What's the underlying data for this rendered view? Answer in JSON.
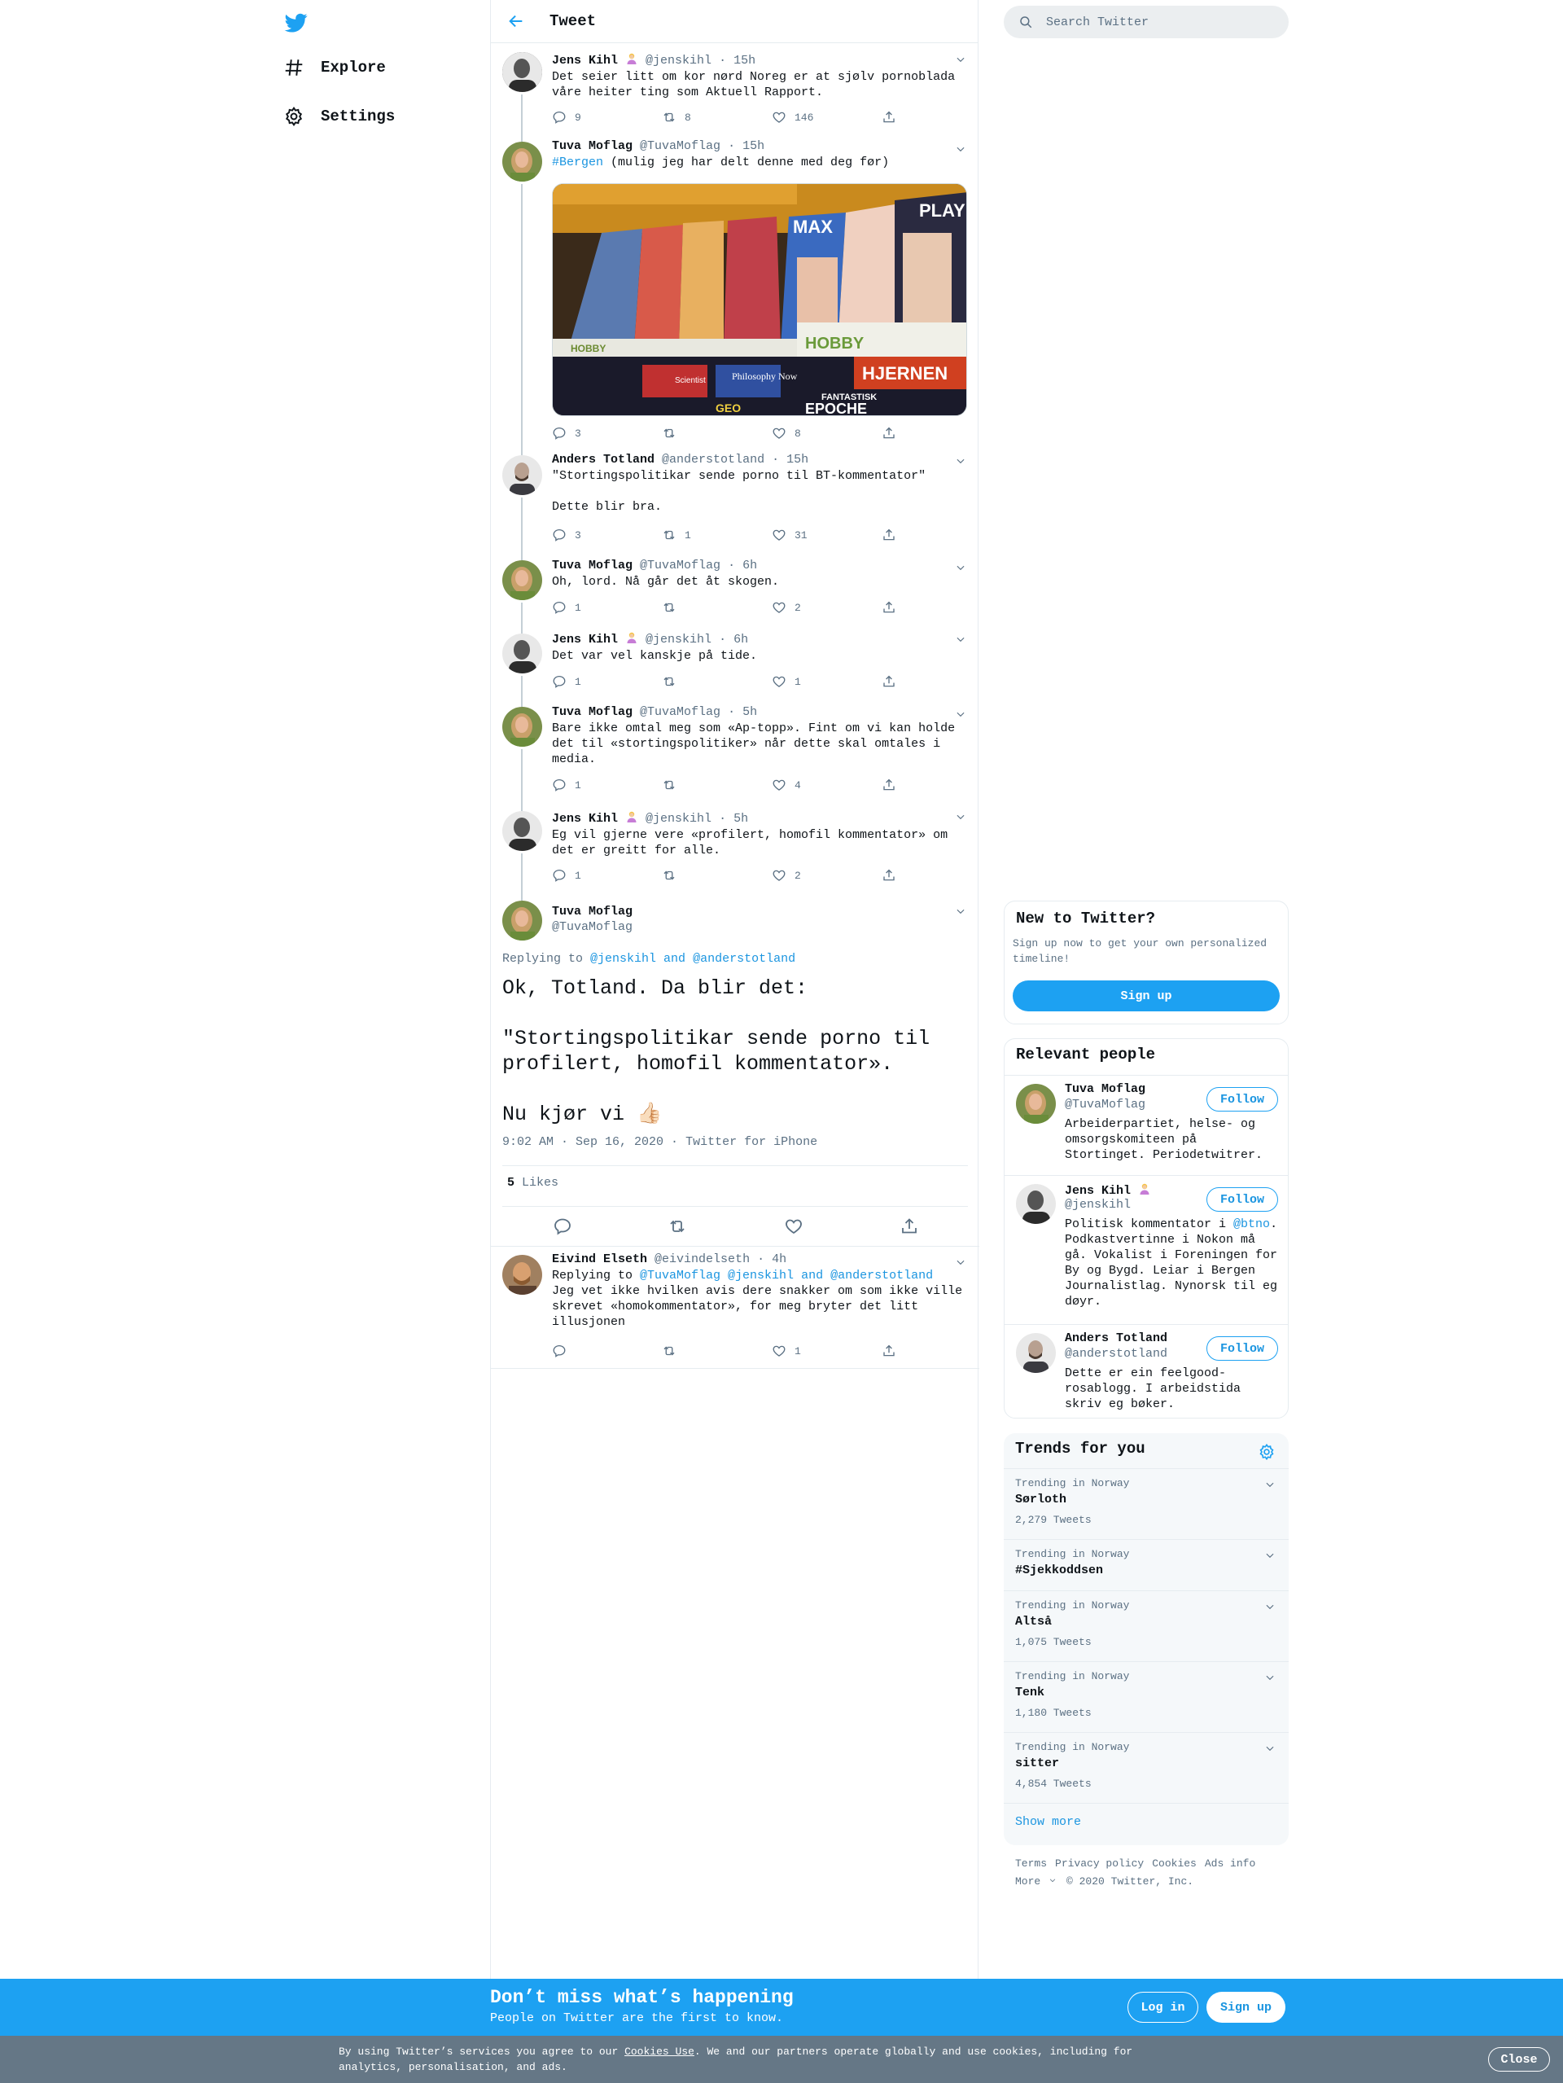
{
  "nav": {
    "logo": "twitter-bird-icon",
    "items": [
      {
        "label": "Explore",
        "icon": "hashtag-icon"
      },
      {
        "label": "Settings",
        "icon": "gear-icon"
      }
    ]
  },
  "header": {
    "title": "Tweet"
  },
  "thread": [
    {
      "name": "Jens Kihl",
      "emoji": "🙎‍♀️",
      "handle": "@jenskihl",
      "time": "· 15h",
      "text": "Det seier litt om kor nørd Noreg er at sjølv pornoblada våre heiter ting som Aktuell Rapport.",
      "replies": "9",
      "retweets": "8",
      "likes": "146"
    },
    {
      "name": "Tuva Moflag",
      "handle": "@TuvaMoflag",
      "time": "· 15h",
      "hashtag": "#Bergen",
      "text": " (mulig jeg har delt denne med deg før)",
      "replies": "3",
      "retweets": "",
      "likes": "8",
      "image": {
        "description": "magazine-rack-photo",
        "shelf_labels": [
          "HOBBY",
          "HOBBY"
        ],
        "magazine_titles": [
          "PLAY",
          "MAX",
          "Scientist",
          "Philosophy Now",
          "GEO",
          "EPOCHE",
          "FANTASTISK",
          "HJERNEN"
        ]
      }
    },
    {
      "name": "Anders Totland",
      "handle": "@anderstotland",
      "time": "· 15h",
      "text": "\"Stortingspolitikar sende porno til BT-kommentator\"\n\nDette blir bra.",
      "replies": "3",
      "retweets": "1",
      "likes": "31"
    },
    {
      "name": "Tuva Moflag",
      "handle": "@TuvaMoflag",
      "time": "· 6h",
      "text": "Oh, lord. Nå går det åt skogen.",
      "replies": "1",
      "retweets": "",
      "likes": "2"
    },
    {
      "name": "Jens Kihl",
      "emoji": "🙎‍♀️",
      "handle": "@jenskihl",
      "time": "· 6h",
      "text": "Det var vel kanskje på tide.",
      "replies": "1",
      "retweets": "",
      "likes": "1"
    },
    {
      "name": "Tuva Moflag",
      "handle": "@TuvaMoflag",
      "time": "· 5h",
      "text": "Bare ikke omtal meg som «Ap-topp». Fint om vi kan holde det til «stortingspolitiker» når dette skal omtales i media.",
      "replies": "1",
      "retweets": "",
      "likes": "4"
    },
    {
      "name": "Jens Kihl",
      "emoji": "🙎‍♀️",
      "handle": "@jenskihl",
      "time": "· 5h",
      "text": "Eg vil gjerne vere «profilert, homofil kommentator» om det er greitt for alle.",
      "replies": "1",
      "retweets": "",
      "likes": "2"
    }
  ],
  "main_tweet": {
    "name": "Tuva Moflag",
    "handle": "@TuvaMoflag",
    "replying_prefix": "Replying to ",
    "replying_to_1": "@jenskihl",
    "replying_and": " and ",
    "replying_to_2": "@anderstotland",
    "text": "Ok, Totland. Da blir det:\n\n\"Stortingspolitikar sende porno til profilert, homofil kommentator».\n\nNu kjør vi 👍🏻",
    "time": "9:02 AM · Sep 16, 2020",
    "source": "Twitter for iPhone",
    "likes_count": "5",
    "likes_label": "Likes"
  },
  "reply": {
    "name": "Eivind Elseth",
    "handle": "@eivindelseth",
    "time": "· 4h",
    "replying_prefix": "Replying to ",
    "replying_to": "@TuvaMoflag @jenskihl and @anderstotland",
    "text": "Jeg vet ikke hvilken avis dere snakker om som ikke ville skrevet «homokommentator», for meg bryter det litt illusjonen",
    "replies": "",
    "retweets": "",
    "likes": "1"
  },
  "search": {
    "placeholder": "Search Twitter"
  },
  "new_to_twitter": {
    "title": "New to Twitter?",
    "subtitle": "Sign up now to get your own personalized timeline!",
    "button": "Sign up"
  },
  "relevant_people": {
    "title": "Relevant people",
    "follow_label": "Follow",
    "people": [
      {
        "name": "Tuva Moflag",
        "handle": "@TuvaMoflag",
        "bio": "Arbeiderpartiet, helse- og omsorgskomiteen på Stortinget. Periodetwitrer."
      },
      {
        "name": "Jens Kihl",
        "emoji": "🙎‍♀️",
        "handle": "@jenskihl",
        "bio_prefix": "Politisk kommentator i ",
        "bio_link": "@btno",
        "bio_suffix": ". Podkastvertinne i Nokon må gå. Vokalist i Foreningen for By og Bygd. Leiar i Bergen Journalistlag. Nynorsk til eg døyr."
      },
      {
        "name": "Anders Totland",
        "handle": "@anderstotland",
        "bio": "Dette er ein feelgood-rosablogg. I arbeidstida skriv eg bøker."
      }
    ]
  },
  "trends": {
    "title": "Trends for you",
    "items": [
      {
        "context": "Trending in Norway",
        "name": "Sørloth",
        "count": "2,279 Tweets"
      },
      {
        "context": "Trending in Norway",
        "name": "#Sjekkoddsen",
        "count": ""
      },
      {
        "context": "Trending in Norway",
        "name": "Altså",
        "count": "1,075 Tweets"
      },
      {
        "context": "Trending in Norway",
        "name": "Tenk",
        "count": "1,180 Tweets"
      },
      {
        "context": "Trending in Norway",
        "name": "sitter",
        "count": "4,854 Tweets"
      }
    ],
    "show_more": "Show more"
  },
  "footer": {
    "links": [
      "Terms",
      "Privacy policy",
      "Cookies",
      "Ads info"
    ],
    "more": "More",
    "copyright": "© 2020 Twitter, Inc."
  },
  "bottom_bar": {
    "title": "Don’t miss what’s happening",
    "subtitle": "People on Twitter are the first to know.",
    "login": "Log in",
    "signup": "Sign up"
  },
  "cookie_bar": {
    "text_before": "By using Twitter’s services you agree to our ",
    "link": "Cookies Use",
    "text_after": ". We and our partners operate globally and use cookies, including for analytics, personalisation, and ads.",
    "close": "Close"
  },
  "colors": {
    "accent": "#1da1f2",
    "link": "#1b95e0",
    "muted": "#5b7083",
    "cookie_bg": "#657786"
  }
}
